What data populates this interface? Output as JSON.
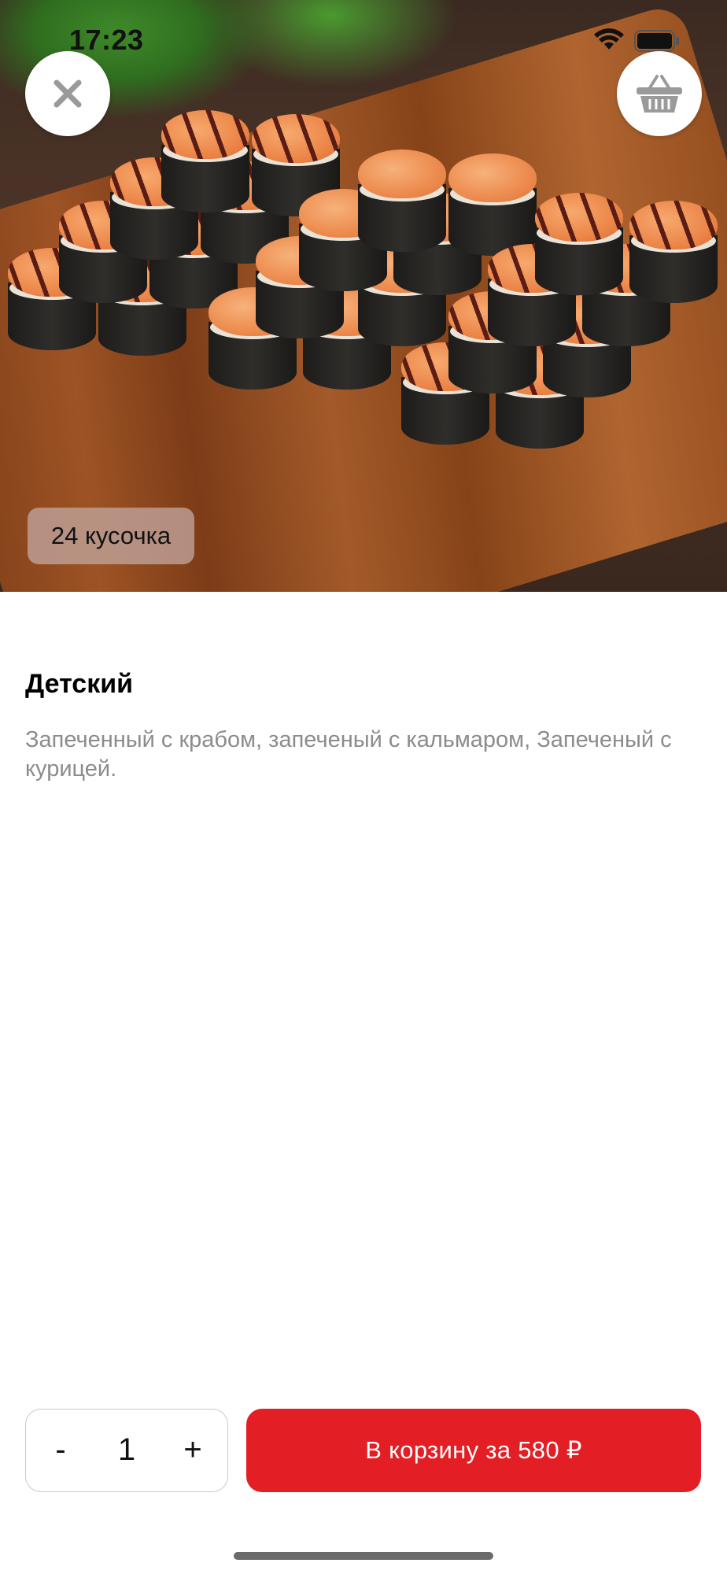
{
  "status_bar": {
    "time": "17:23"
  },
  "product": {
    "pieces_badge": "24 кусочка",
    "title": "Детский",
    "description": "Запеченный с крабом, запеченый с кальмаром, Запеченый с курицей."
  },
  "buttons": {
    "close_icon": "close-icon",
    "basket_icon": "basket-icon"
  },
  "order": {
    "minus_label": "-",
    "quantity": "1",
    "plus_label": "+",
    "add_to_cart_label": "В корзину за 580 ₽"
  },
  "colors": {
    "accent": "#e31e24",
    "description_text": "#8c8c8c"
  }
}
